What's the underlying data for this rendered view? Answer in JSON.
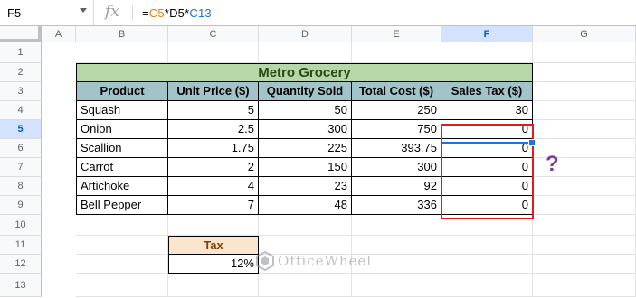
{
  "formula_bar": {
    "name_box": "F5",
    "fx": "fx",
    "formula_parts": [
      "=",
      "C5",
      "*",
      "D5",
      "*",
      "C13"
    ]
  },
  "columns": [
    "A",
    "B",
    "C",
    "D",
    "E",
    "F",
    "G"
  ],
  "selected_column": "F",
  "rows": [
    "1",
    "2",
    "3",
    "4",
    "5",
    "6",
    "7",
    "8",
    "9",
    "10",
    "11",
    "12",
    "13"
  ],
  "selected_row": "5",
  "table": {
    "title": "Metro Grocery",
    "headers": [
      "Product",
      "Unit Price ($)",
      "Quantity Sold",
      "Total Cost ($)",
      "Sales Tax ($)"
    ],
    "rows": [
      [
        "Squash",
        "5",
        "50",
        "250",
        "30"
      ],
      [
        "Onion",
        "2.5",
        "300",
        "750",
        "0"
      ],
      [
        "Scallion",
        "1.75",
        "225",
        "393.75",
        "0"
      ],
      [
        "Carrot",
        "2",
        "150",
        "300",
        "0"
      ],
      [
        "Artichoke",
        "4",
        "23",
        "92",
        "0"
      ],
      [
        "Bell Pepper",
        "7",
        "48",
        "336",
        "0"
      ]
    ]
  },
  "tax": {
    "label": "Tax",
    "value": "12%"
  },
  "annotation": "?",
  "watermark": "OfficeWheel",
  "colors": {
    "title_fill": "#b6d7a8",
    "header_fill": "#a2c4c9",
    "tax_fill": "#fce5cd",
    "highlight_box": "#e01b24",
    "selection": "#1a73e8",
    "question_mark": "#7b3f96"
  }
}
